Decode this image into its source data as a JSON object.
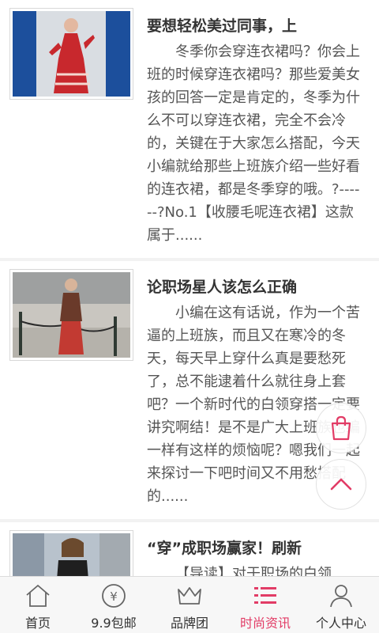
{
  "articles": [
    {
      "title": "要想轻松美过同事，上",
      "excerpt": "冬季你会穿连衣裙吗？你会上班的时候穿连衣裙吗？那些爱美女孩的回答一定是肯定的，冬季为什么不可以穿连衣裙，完全不会冷的，关键在于大家怎么搭配，今天小编就给那些上班族介绍一些好看的连衣裙，都是冬季穿的哦。?------?No.1【收腰毛呢连衣裙】这款属于......"
    },
    {
      "title": "论职场星人该怎么正确",
      "excerpt": "小编在这有话说，作为一个苦逼的上班族，而且又在寒冷的冬天，每天早上穿什么真是要愁死了，总不能逮着什么就往身上套吧？一个新时代的白领穿搭一定要讲究啊结！是不是广大上班族也编一样有这样的烦恼呢？嗯我们一起来探讨一下吧时间又不用愁搭配的......"
    },
    {
      "title": "“穿”成职场赢家！刷新",
      "excerpt": "【导读】对于职场的白领"
    }
  ],
  "tabs": [
    {
      "label": "首页",
      "icon": "home-icon",
      "active": false
    },
    {
      "label": "9.9包邮",
      "icon": "yen-coin-icon",
      "active": false
    },
    {
      "label": "品牌团",
      "icon": "crown-icon",
      "active": false
    },
    {
      "label": "时尚资讯",
      "icon": "list-icon",
      "active": true
    },
    {
      "label": "个人中心",
      "icon": "user-icon",
      "active": false
    }
  ],
  "colors": {
    "accent": "#e23c66",
    "text": "#333333",
    "excerpt": "#555555"
  }
}
